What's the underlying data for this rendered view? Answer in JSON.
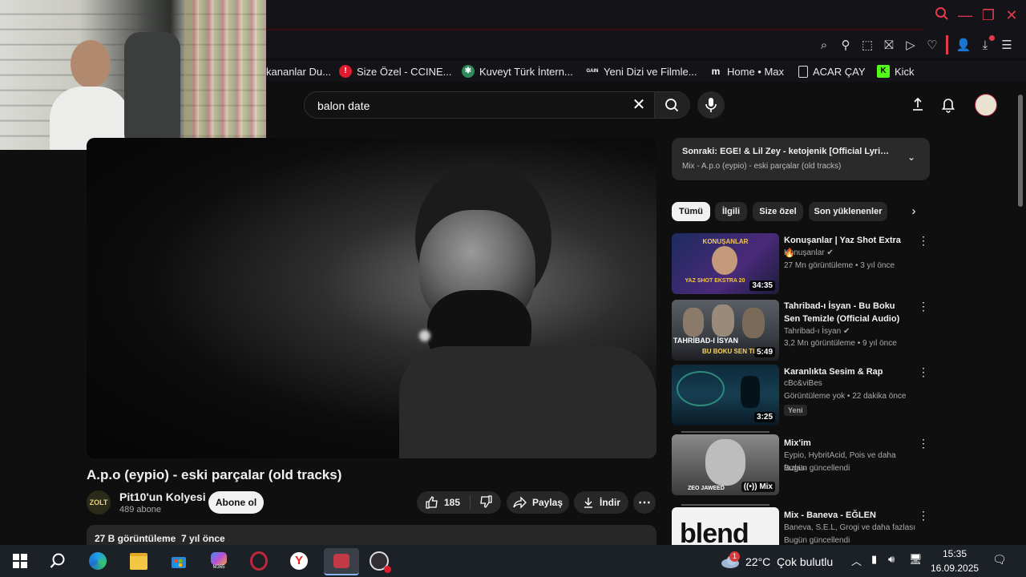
{
  "browser": {
    "bookmarks": [
      {
        "label": "kananlar Du...",
        "icon": "bookmark-icon"
      },
      {
        "label": "Size Özel - CCINE...",
        "icon": "ccine-icon",
        "color": "#e01b2e"
      },
      {
        "label": "Kuveyt Türk İntern...",
        "icon": "kuveyt-turk-icon",
        "color": "#2d8a5a"
      },
      {
        "label": "Yeni Dizi ve Filmle...",
        "icon": "gain-icon",
        "badge": "GAIN"
      },
      {
        "label": "Home • Max",
        "icon": "max-icon",
        "badge": "m"
      },
      {
        "label": "ACAR ÇAY",
        "icon": "document-icon"
      },
      {
        "label": "Kick",
        "icon": "kick-icon",
        "color": "#53fc18",
        "badge": "K"
      }
    ]
  },
  "search": {
    "value": "balon date"
  },
  "video": {
    "title": "A.p.o (eypio) - eski parçalar (old tracks)",
    "channel": "Pit10'un Kolyesi",
    "channel_avatar_text": "ZOLT",
    "subscribers": "489 abone",
    "subscribe_label": "Abone ol",
    "likes": "185",
    "share_label": "Paylaş",
    "download_label": "İndir",
    "views_line": "27 B görüntüleme  7 yıl önce"
  },
  "sidebar": {
    "next_title": "Sonraki: EGE! & Lil Zey - ketojenik [Official Lyric Vid...",
    "next_sub": "Mix - A.p.o (eypio) - eski parçalar (old tracks)",
    "chips": [
      "Tümü",
      "İlgili",
      "Size özel",
      "Son yüklenenler"
    ],
    "videos": [
      {
        "title": "Konuşanlar | Yaz Shot Extra 🔥",
        "channel": "Konuşanlar",
        "verified": true,
        "meta": "27 Mn görüntüleme • 3 yıl önce",
        "duration": "34:35",
        "thumb_text": "KONUŞANLAR",
        "thumb_text2": "YAZ SHOT EKSTRA 20"
      },
      {
        "title": "Tahribad-ı İsyan - Bu Boku Sen Temizle (Official Audio)",
        "channel": "Tahribad-ı İsyan",
        "verified": true,
        "meta": "3,2 Mn görüntüleme • 9 yıl önce",
        "duration": "5:49",
        "thumb_text": "TAHRİBAD-I İSYAN",
        "thumb_text2": "BU BOKU SEN TE..."
      },
      {
        "title": "Karanlıkta Sesim & Rap",
        "channel": "cBc&viBes",
        "verified": false,
        "meta": "Görüntüleme yok • 22 dakika önce",
        "duration": "3:25",
        "badge": "Yeni"
      },
      {
        "title": "Mix'im",
        "channel": "Eypio, HybritAcid, Pois ve daha fazlası",
        "verified": false,
        "meta": "Bugün güncellendi",
        "duration": "Mix",
        "thumb_text": "ZEO JAWEED"
      },
      {
        "title": "Mix - Baneva - EĞLEN",
        "channel": "Baneva, S.E.L, Grogi ve daha fazlası",
        "verified": false,
        "meta": "Bugün güncellendi",
        "thumb_text": "blend"
      }
    ]
  },
  "taskbar": {
    "weather_badge": "1",
    "weather_temp": "22°C  Çok bulutlu",
    "time": "15:35",
    "date": "16.09.2025",
    "m365_label": "M365"
  }
}
